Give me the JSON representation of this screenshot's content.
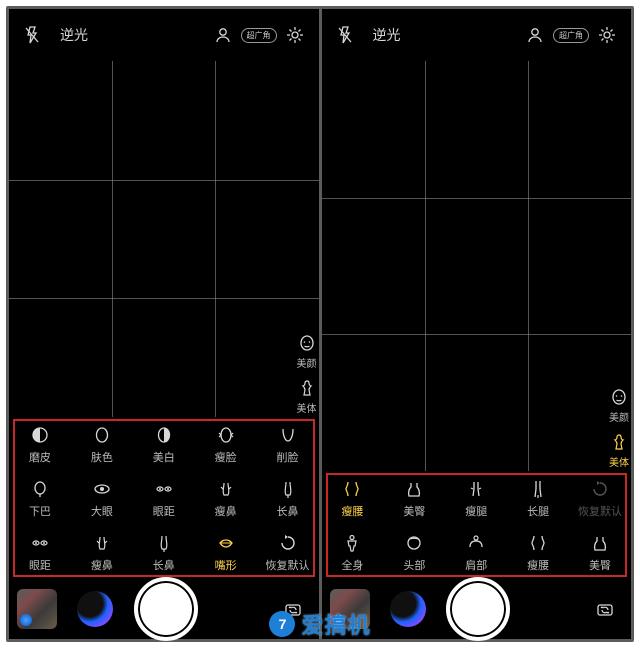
{
  "left": {
    "topbar": {
      "light_label": "逆光",
      "wide_label": "超广角"
    },
    "side_tabs": [
      {
        "id": "beauty",
        "label": "美颜",
        "icon": "face-icon",
        "active": false
      },
      {
        "id": "body",
        "label": "美体",
        "icon": "body-icon",
        "active": false
      }
    ],
    "options": [
      [
        {
          "id": "mopi",
          "label": "磨皮",
          "icon": "half-circle-left-icon"
        },
        {
          "id": "fuse",
          "label": "肤色",
          "icon": "oval-icon"
        },
        {
          "id": "meibai",
          "label": "美白",
          "icon": "half-oval-icon"
        },
        {
          "id": "shoulian",
          "label": "瘦脸",
          "icon": "face-squeeze-icon"
        },
        {
          "id": "xuelian",
          "label": "削脸",
          "icon": "face-v-icon"
        }
      ],
      [
        {
          "id": "xiaba",
          "label": "下巴",
          "icon": "chin-icon"
        },
        {
          "id": "dayan",
          "label": "大眼",
          "icon": "eye-icon"
        },
        {
          "id": "yanju",
          "label": "眼距",
          "icon": "eye-distance-icon"
        },
        {
          "id": "shoubi",
          "label": "瘦鼻",
          "icon": "nose-slim-icon"
        },
        {
          "id": "changbi",
          "label": "长鼻",
          "icon": "nose-long-icon"
        }
      ],
      [
        {
          "id": "yanju2",
          "label": "眼距",
          "icon": "eye-distance-icon"
        },
        {
          "id": "shoubi2",
          "label": "瘦鼻",
          "icon": "nose-slim-icon"
        },
        {
          "id": "changbi2",
          "label": "长鼻",
          "icon": "nose-long-icon"
        },
        {
          "id": "zuixing",
          "label": "嘴形",
          "icon": "lips-icon",
          "active": true
        },
        {
          "id": "reset",
          "label": "恢复默认",
          "icon": "reset-icon"
        }
      ]
    ]
  },
  "right": {
    "topbar": {
      "light_label": "逆光",
      "wide_label": "超广角"
    },
    "side_tabs": [
      {
        "id": "beauty",
        "label": "美颜",
        "icon": "face-icon",
        "active": false
      },
      {
        "id": "body",
        "label": "美体",
        "icon": "body-icon",
        "active": true
      }
    ],
    "options": [
      [
        {
          "id": "shouyao",
          "label": "瘦腰",
          "icon": "waist-icon",
          "active": true
        },
        {
          "id": "meitun",
          "label": "美臀",
          "icon": "hip-icon"
        },
        {
          "id": "shoutui",
          "label": "瘦腿",
          "icon": "leg-slim-icon"
        },
        {
          "id": "changtui",
          "label": "长腿",
          "icon": "leg-long-icon"
        },
        {
          "id": "reset",
          "label": "恢复默认",
          "icon": "reset-icon",
          "dim": true
        }
      ],
      [
        {
          "id": "quanshen",
          "label": "全身",
          "icon": "full-body-icon"
        },
        {
          "id": "toubu",
          "label": "头部",
          "icon": "head-icon"
        },
        {
          "id": "jianbu",
          "label": "肩部",
          "icon": "shoulder-icon"
        },
        {
          "id": "shouyao2",
          "label": "瘦腰",
          "icon": "waist-icon"
        },
        {
          "id": "meitun2",
          "label": "美臀",
          "icon": "hip-icon"
        }
      ]
    ]
  },
  "watermark": {
    "badge": "7",
    "text": "爱搞机"
  }
}
